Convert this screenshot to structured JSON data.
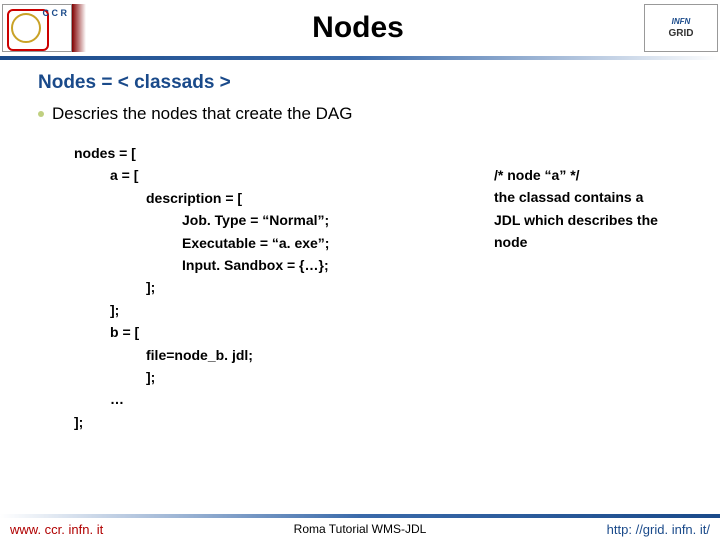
{
  "header": {
    "title": "Nodes",
    "logo_left_letters": "C\nC\nR",
    "logo_right_top": "INFN",
    "logo_right_bottom": "GRID"
  },
  "content": {
    "subtitle": "Nodes = < classads >",
    "bullet": "Descries the nodes that create the DAG"
  },
  "code": {
    "l0": "nodes = [",
    "l1": "a = [",
    "l2": "description = [",
    "l3": "Job. Type = “Normal”;",
    "l4": "Executable = “a. exe”;",
    "l5": "Input. Sandbox = {…};",
    "l6": "];",
    "l7": "];",
    "l8": "b = [",
    "l9": "file=node_b. jdl;",
    "l10": "];",
    "l11": "…",
    "l12": "];"
  },
  "annot": {
    "a0": "/* node “a” */",
    "a1": "the classad contains a",
    "a2": "JDL which describes the",
    "a3": "node"
  },
  "footer": {
    "left": "www. ccr. infn. it",
    "mid": "Roma Tutorial   WMS-JDL",
    "right": "http: //grid. infn. it/"
  }
}
